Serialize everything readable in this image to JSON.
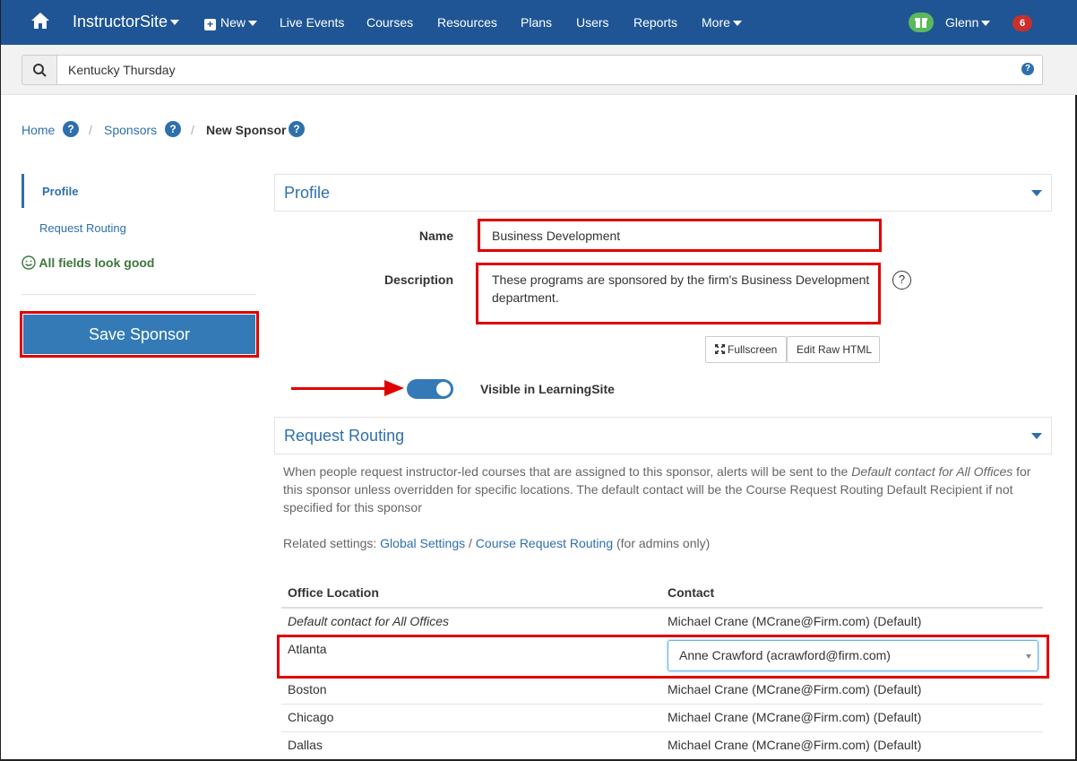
{
  "nav": {
    "brand": "InstructorSite",
    "new_label": "New",
    "items": [
      "Live Events",
      "Courses",
      "Resources",
      "Plans",
      "Users",
      "Reports",
      "More"
    ],
    "user": "Glenn",
    "notifications": "6",
    "accent": "#1f5594"
  },
  "search": {
    "value": "Kentucky Thursday"
  },
  "breadcrumb": {
    "home": "Home",
    "sponsors": "Sponsors",
    "current": "New Sponsor",
    "sep": "/"
  },
  "sidebar": {
    "profile": "Profile",
    "request_routing": "Request Routing",
    "status": "All fields look good",
    "save_label": "Save Sponsor"
  },
  "profile": {
    "title": "Profile",
    "name_label": "Name",
    "name_value": "Business Development",
    "description_label": "Description",
    "description_value": "These programs are sponsored by the firm's Business Development department.",
    "help": "?",
    "fullscreen_label": "Fullscreen",
    "raw_html_label": "Edit Raw HTML",
    "visible_label": "Visible in LearningSite",
    "visible_on": true
  },
  "routing": {
    "title": "Request Routing",
    "text_1": "When people request instructor-led courses that are assigned to this sponsor, alerts will be sent to the ",
    "text_italic": "Default contact for All Offices",
    "text_2": " for this sponsor unless overridden for specific locations. The default contact will be the Course Request Routing Default Recipient if not specified for this sponsor",
    "related_prefix": "Related settings: ",
    "related_link_1": "Global Settings",
    "related_sep": " / ",
    "related_link_2": "Course Request Routing",
    "related_suffix": " (for admins only)",
    "col_office": "Office Location",
    "col_contact": "Contact",
    "rows": [
      {
        "office": "Default contact for All Offices",
        "contact": "Michael Crane (MCrane@Firm.com) (Default)"
      },
      {
        "office": "Atlanta",
        "contact": "Anne Crawford (acrawford@firm.com)"
      },
      {
        "office": "Boston",
        "contact": "Michael Crane (MCrane@Firm.com) (Default)"
      },
      {
        "office": "Chicago",
        "contact": "Michael Crane (MCrane@Firm.com) (Default)"
      },
      {
        "office": "Dallas",
        "contact": "Michael Crane (MCrane@Firm.com) (Default)"
      }
    ]
  }
}
